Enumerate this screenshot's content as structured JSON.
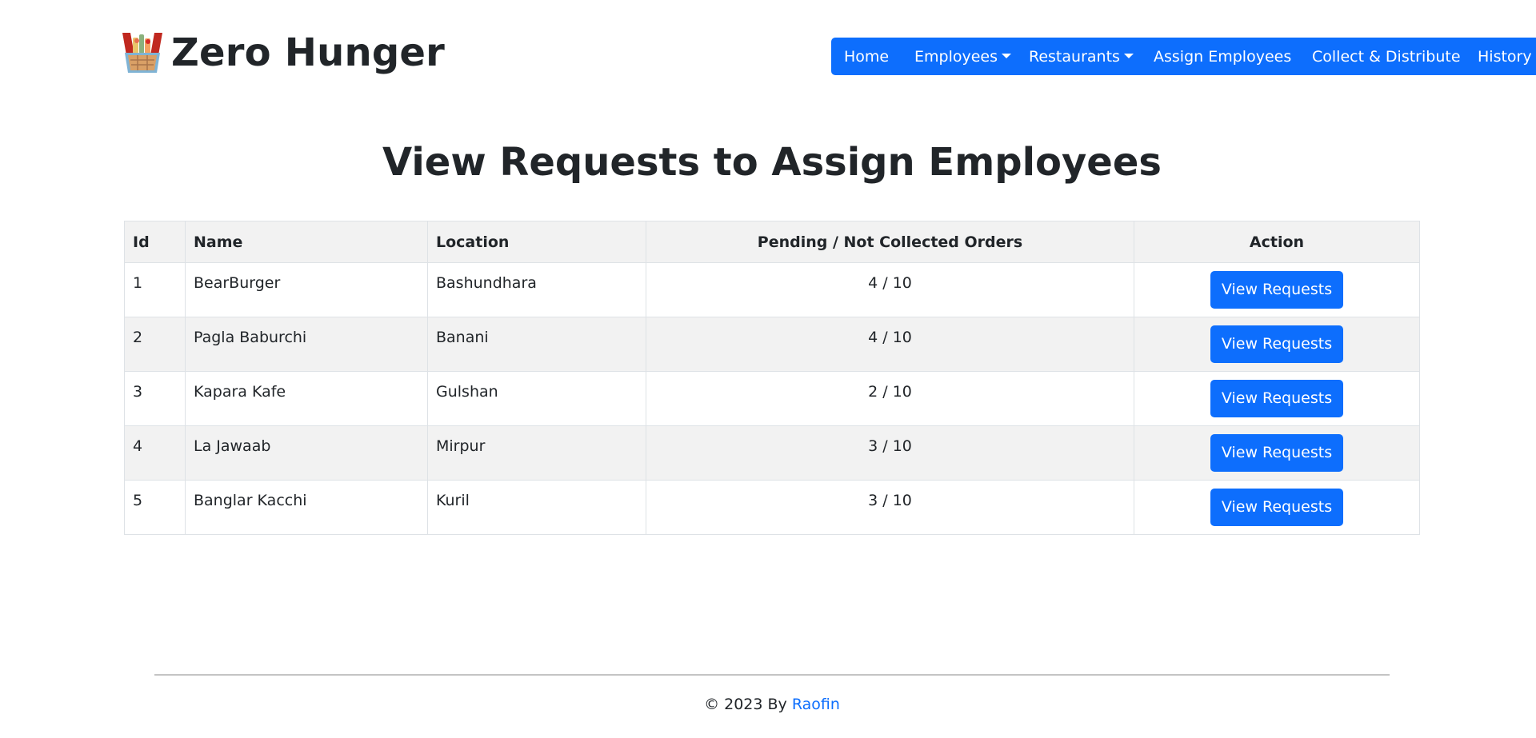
{
  "brand": {
    "title": "Zero Hunger",
    "logo_icon": "food-basket-icon"
  },
  "nav": {
    "home": "Home",
    "employees": "Employees",
    "restaurants": "Restaurants",
    "assign_employees": "Assign Employees",
    "collect_distribute": "Collect & Distribute",
    "history": "History"
  },
  "main": {
    "title": "View Requests to Assign Employees"
  },
  "table": {
    "headers": {
      "id": "Id",
      "name": "Name",
      "location": "Location",
      "orders": "Pending / Not Collected Orders",
      "action": "Action"
    },
    "rows": [
      {
        "id": "1",
        "name": "BearBurger",
        "location": "Bashundhara",
        "orders": "4 / 10",
        "action": "View Requests"
      },
      {
        "id": "2",
        "name": "Pagla Baburchi",
        "location": "Banani",
        "orders": "4 / 10",
        "action": "View Requests"
      },
      {
        "id": "3",
        "name": "Kapara Kafe",
        "location": "Gulshan",
        "orders": "2 / 10",
        "action": "View Requests"
      },
      {
        "id": "4",
        "name": "La Jawaab",
        "location": "Mirpur",
        "orders": "3 / 10",
        "action": "View Requests"
      },
      {
        "id": "5",
        "name": "Banglar Kacchi",
        "location": "Kuril",
        "orders": "3 / 10",
        "action": "View Requests"
      }
    ]
  },
  "footer": {
    "prefix": "© 2023 By ",
    "link": "Raofin"
  },
  "colors": {
    "primary": "#0d6efd",
    "text": "#212529",
    "stripe": "#f2f2f2",
    "border": "#dee2e6"
  }
}
